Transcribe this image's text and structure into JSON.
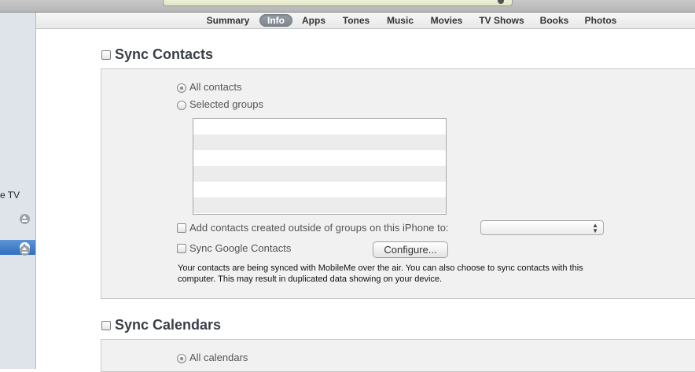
{
  "sidebar": {
    "partial_label": "e TV"
  },
  "tabs": [
    {
      "label": "Summary"
    },
    {
      "label": "Info"
    },
    {
      "label": "Apps"
    },
    {
      "label": "Tones"
    },
    {
      "label": "Music"
    },
    {
      "label": "Movies"
    },
    {
      "label": "TV Shows"
    },
    {
      "label": "Books"
    },
    {
      "label": "Photos"
    }
  ],
  "active_tab": "Info",
  "contacts": {
    "title": "Sync Contacts",
    "checked": false,
    "option_all": "All contacts",
    "option_selected": "Selected groups",
    "selected_option": "All contacts",
    "add_outside_label": "Add contacts created outside of groups on this iPhone to:",
    "group_select_value": "",
    "google_label": "Sync Google Contacts",
    "configure_label": "Configure...",
    "note_line1": "Your contacts are being synced with MobileMe over the air. You can also choose to sync contacts with this",
    "note_line2": "computer. This may result in duplicated data showing on your device."
  },
  "calendars": {
    "title": "Sync Calendars",
    "checked": false,
    "option_all": "All calendars"
  },
  "colors": {
    "tab_active_bg": "#8a9098",
    "selection_blue": "#3a7acb",
    "panel_bg": "#f1f1f1"
  }
}
